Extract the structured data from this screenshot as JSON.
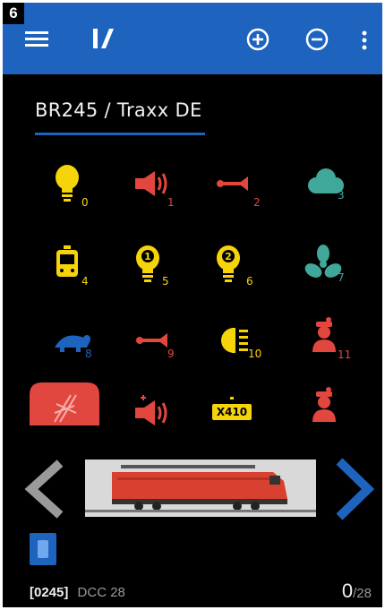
{
  "badge": "6",
  "colors": {
    "appbar": "#1e63bd",
    "background": "#000000",
    "yellow": "#f6d40a",
    "red": "#e2473f",
    "teal": "#3fa89a",
    "blue": "#1e63bd",
    "grey_arrow": "#9a9a9a"
  },
  "appbar": {
    "menu_icon": "hamburger-menu-icon",
    "logo_icon": "app-logo-icon",
    "zoom_in_icon": "plus-circle-icon",
    "zoom_out_icon": "minus-circle-icon",
    "more_icon": "more-vertical-icon"
  },
  "loco": {
    "name": "BR245 / Traxx DE",
    "address": "[0245]",
    "protocol": "DCC 28",
    "speed": "0",
    "speed_max": "/28"
  },
  "functions": [
    {
      "number": "0",
      "icon": "light-bulb-icon",
      "color": "#f6d40a"
    },
    {
      "number": "1",
      "icon": "speaker-icon",
      "color": "#e2473f"
    },
    {
      "number": "2",
      "icon": "horn-icon",
      "color": "#e2473f"
    },
    {
      "number": "3",
      "icon": "cloud-smoke-icon",
      "color": "#3fa89a"
    },
    {
      "number": "4",
      "icon": "cab-icon",
      "color": "#f6d40a"
    },
    {
      "number": "5",
      "icon": "light-bulb-1-icon",
      "color": "#f6d40a"
    },
    {
      "number": "6",
      "icon": "light-bulb-2-icon",
      "color": "#f6d40a"
    },
    {
      "number": "7",
      "icon": "fan-icon",
      "color": "#3fa89a"
    },
    {
      "number": "8",
      "icon": "turtle-shunting-icon",
      "color": "#1e63bd"
    },
    {
      "number": "9",
      "icon": "horn-icon",
      "color": "#e2473f"
    },
    {
      "number": "10",
      "icon": "headlight-icon",
      "color": "#f6d40a"
    },
    {
      "number": "11",
      "icon": "conductor-icon",
      "color": "#e2473f"
    },
    {
      "number": "",
      "icon": "pantograph-icon",
      "color": "#e2473f"
    },
    {
      "number": "",
      "icon": "speaker-plus-icon",
      "color": "#e2473f"
    },
    {
      "number": "",
      "icon": "x410-label-icon",
      "color": "#f6d40a",
      "label": "X410"
    },
    {
      "number": "",
      "icon": "conductor-icon",
      "color": "#e2473f"
    }
  ],
  "navigation": {
    "prev_icon": "chevron-left-icon",
    "next_icon": "chevron-right-icon"
  }
}
